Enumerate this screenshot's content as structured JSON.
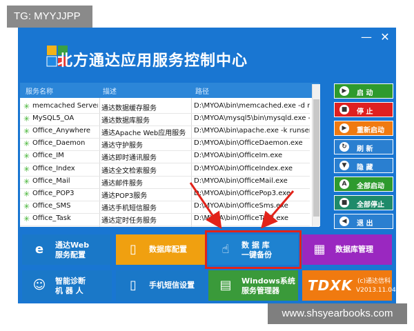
{
  "overlay": {
    "tag": "TG: MYYJJPP",
    "watermark": "www.shsyearbooks.com"
  },
  "window": {
    "title": "北方通达应用服务控制中心",
    "minimize": "—",
    "close": "✕"
  },
  "table": {
    "headers": [
      "服务名称",
      "描述",
      "路径"
    ],
    "rows": [
      {
        "name": "memcached Server",
        "desc": "通达数据缓存服务",
        "path": "D:\\MYOA\\bin\\memcached.exe -d runs..."
      },
      {
        "name": "MySQL5_OA",
        "desc": "通达数据库服务",
        "path": "D:\\MYOA\\mysql5\\bin\\mysqld.exe --de..."
      },
      {
        "name": "Office_Anywhere",
        "desc": "通达Apache Web应用服务",
        "path": "D:\\MYOA\\bin\\apache.exe -k runservice"
      },
      {
        "name": "Office_Daemon",
        "desc": "通达守护服务",
        "path": "D:\\MYOA\\bin\\OfficeDaemon.exe"
      },
      {
        "name": "Office_IM",
        "desc": "通达即时通讯服务",
        "path": "D:\\MYOA\\bin\\OfficeIm.exe"
      },
      {
        "name": "Office_Index",
        "desc": "通达全文检索服务",
        "path": "D:\\MYOA\\bin\\OfficeIndex.exe"
      },
      {
        "name": "Office_Mail",
        "desc": "通达邮件服务",
        "path": "D:\\MYOA\\bin\\OfficeMail.exe"
      },
      {
        "name": "Office_POP3",
        "desc": "通达POP3服务",
        "path": "D:\\MYOA\\bin\\OfficePop3.exe"
      },
      {
        "name": "Office_SMS",
        "desc": "通达手机短信服务",
        "path": "D:\\MYOA\\bin\\OfficeSms.exe"
      },
      {
        "name": "Office_Task",
        "desc": "通达定时任务服务",
        "path": "D:\\MYOA\\bin\\OfficeTask.exe"
      }
    ]
  },
  "side_buttons": [
    {
      "label": "启 动",
      "icon": "play-icon",
      "color": "#2e9a2e"
    },
    {
      "label": "停 止",
      "icon": "stop-icon",
      "color": "#e02020"
    },
    {
      "label": "重新启动",
      "icon": "restart-icon",
      "color": "#f07a10"
    },
    {
      "label": "刷 新",
      "icon": "refresh-icon",
      "color": "#2a7fd0"
    },
    {
      "label": "隐 藏",
      "icon": "hide-icon",
      "color": "#2a7fd0"
    },
    {
      "label": "全部启动",
      "icon": "start-all-icon",
      "color": "#2e9a2e"
    },
    {
      "label": "全部停止",
      "icon": "stop-all-icon",
      "color": "#1f8a6a"
    },
    {
      "label": "退 出",
      "icon": "exit-arrow-icon",
      "color": "#2a7fd0"
    }
  ],
  "tiles": [
    {
      "line1": "通达Web",
      "line2": "服务配置",
      "icon": "ie-icon",
      "color": "#1a78c8"
    },
    {
      "line1": "数据库配置",
      "line2": "",
      "icon": "database-config-icon",
      "color": "#f0a010"
    },
    {
      "line1": "数 据 库",
      "line2": "一键备份",
      "icon": "backup-hand-icon",
      "color": "#1e82d0"
    },
    {
      "line1": "数据库管理",
      "line2": "",
      "icon": "database-manage-icon",
      "color": "#9a28c0"
    },
    {
      "line1": "智能诊断",
      "line2": "机 器 人",
      "icon": "robot-icon",
      "color": "#1a78c8"
    },
    {
      "line1": "手机短信设置",
      "line2": "",
      "icon": "phone-icon",
      "color": "#1a78c8"
    },
    {
      "line1": "Windows系统",
      "line2": "服务管理器",
      "icon": "windows-service-icon",
      "color": "#3a9a3a"
    },
    {
      "line1": "(c)通达信科",
      "line2": "V2013.11.04",
      "logo": "TDXK",
      "icon": "tdxk-logo-icon",
      "color": "#f07a10"
    }
  ]
}
